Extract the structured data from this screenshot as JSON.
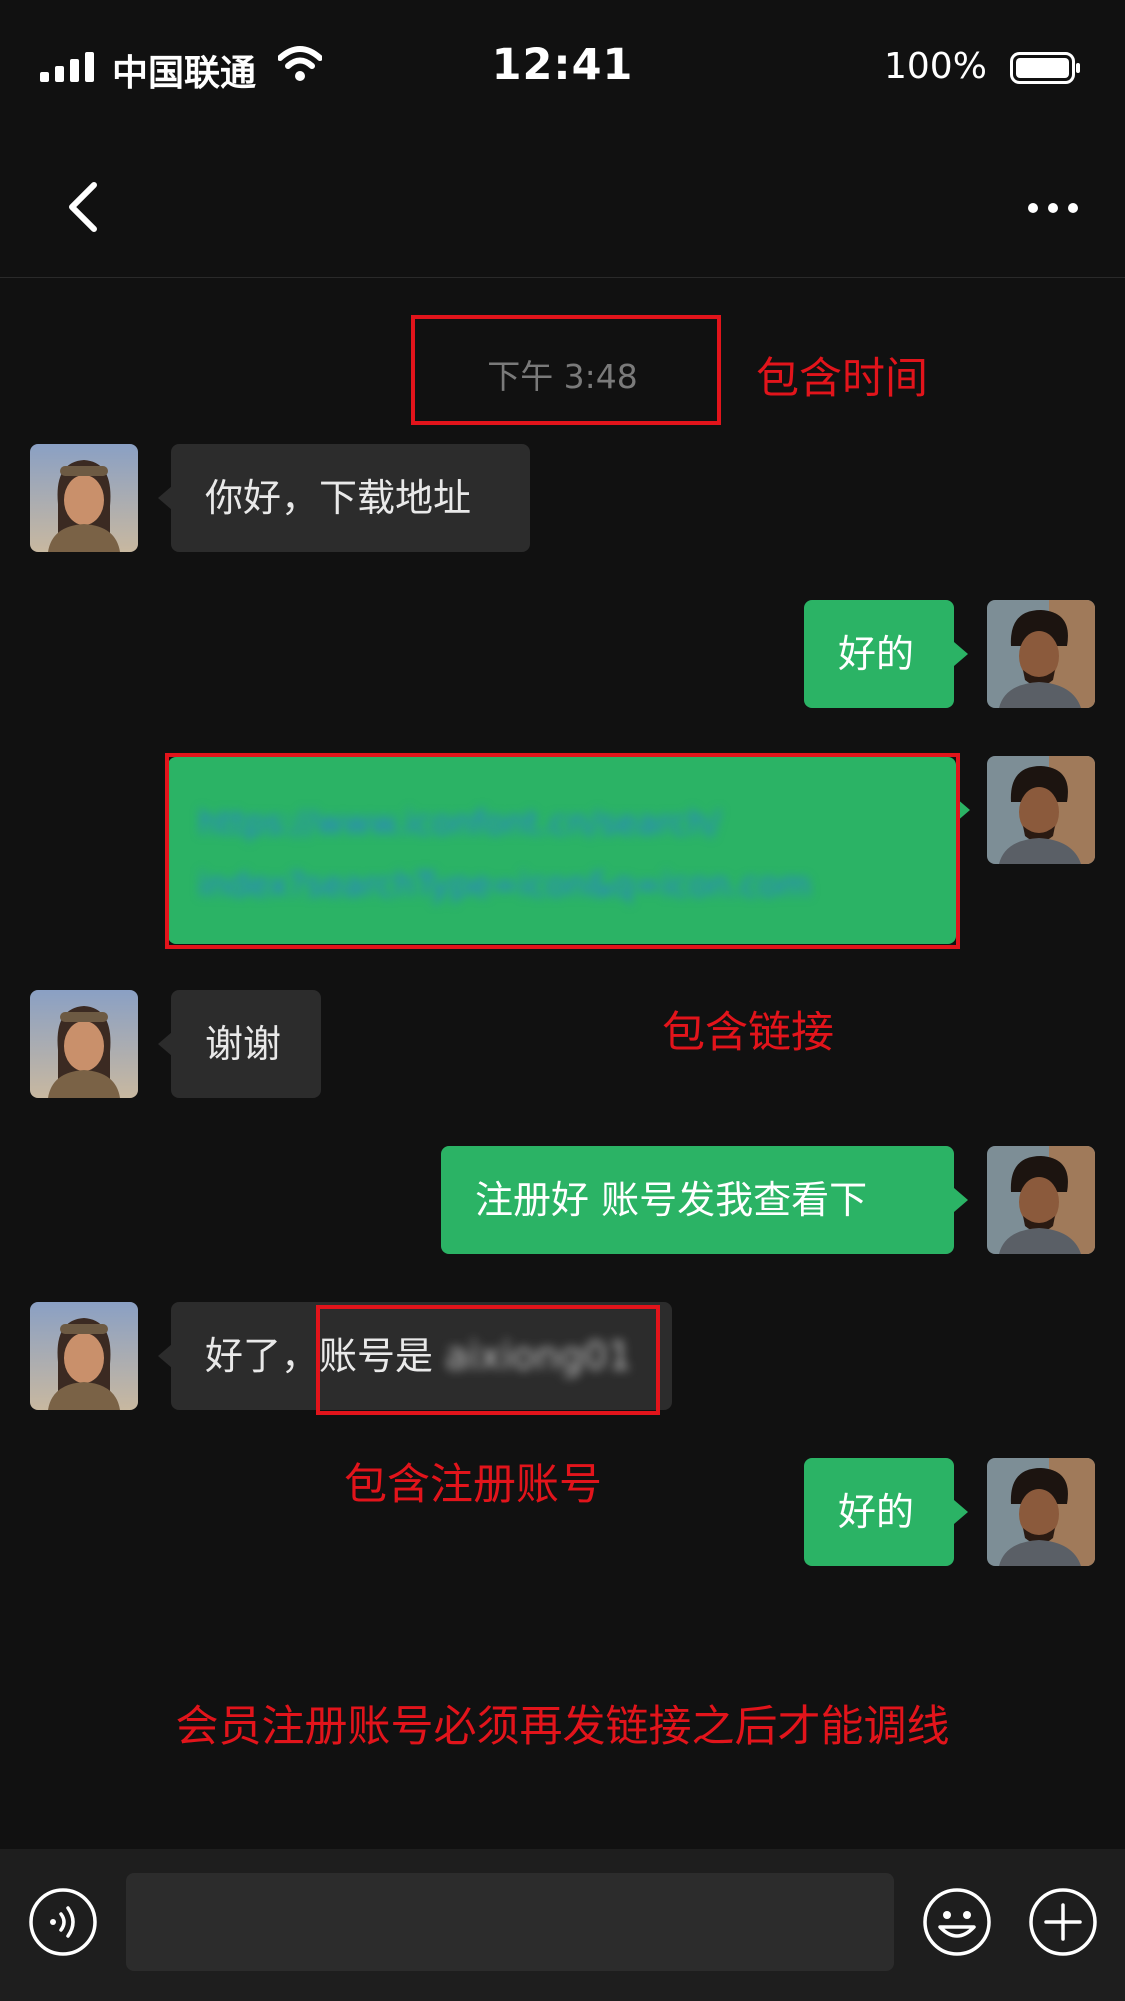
{
  "status_bar": {
    "carrier": "中国联通",
    "time": "12:41",
    "battery": "100%",
    "icons": [
      "signal-icon",
      "wifi-icon",
      "battery-icon"
    ]
  },
  "nav": {
    "back_icon": "chevron-left-icon",
    "more_icon": "more-dots-icon"
  },
  "chat": {
    "timestamp": "下午 3:48",
    "messages": [
      {
        "side": "in",
        "text": "你好，下载地址"
      },
      {
        "side": "out",
        "text": "好的"
      },
      {
        "side": "out",
        "type": "link",
        "line1": "https://www.iconfont.cn/search/",
        "line2": "index?searchType=icon&q=icon.com"
      },
      {
        "side": "in",
        "text": "谢谢"
      },
      {
        "side": "out",
        "text": "注册好 账号发我查看下"
      },
      {
        "side": "in",
        "text_prefix": "好了，",
        "text_label": "账号是",
        "text_value": "aixiong01"
      },
      {
        "side": "out",
        "text": "好的"
      }
    ]
  },
  "annotations": {
    "time_label": "包含时间",
    "link_label": "包含链接",
    "account_label": "包含注册账号",
    "footer_note": "会员注册账号必须再发链接之后才能调线"
  },
  "input_bar": {
    "placeholder": "",
    "icons": [
      "voice-icon",
      "emoji-icon",
      "plus-icon"
    ]
  },
  "colors": {
    "background": "#111111",
    "incoming_bubble": "#2c2c2c",
    "outgoing_bubble": "#2bb365",
    "annotation_red": "#e2141b",
    "link_blue": "#2a7fd6"
  }
}
